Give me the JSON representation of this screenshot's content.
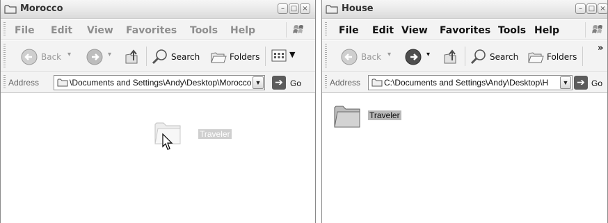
{
  "windows": [
    {
      "title": "Morocco",
      "menu": [
        "File",
        "Edit",
        "View",
        "Favorites",
        "Tools",
        "Help"
      ],
      "toolbar": {
        "back": "Back",
        "search": "Search",
        "folders": "Folders"
      },
      "address": {
        "label": "Address",
        "value": "\\Documents and Settings\\Andy\\Desktop\\Morocco",
        "go": "Go"
      },
      "items": [
        {
          "name": "Traveler",
          "state": "dragging"
        }
      ]
    },
    {
      "title": "House",
      "menu": [
        "File",
        "Edit",
        "View",
        "Favorites",
        "Tools",
        "Help"
      ],
      "toolbar": {
        "back": "Back",
        "search": "Search",
        "folders": "Folders",
        "more": "»"
      },
      "address": {
        "label": "Address",
        "value": "C:\\Documents and Settings\\Andy\\Desktop\\H",
        "go": "Go"
      },
      "items": [
        {
          "name": "Traveler",
          "state": "selected"
        }
      ]
    }
  ],
  "colors": {
    "selection": "#b9b9b9",
    "chrome": "#f3f3f3",
    "go_button": "#5c5c5c"
  },
  "icons": [
    "folder-icon",
    "back-icon",
    "forward-icon",
    "up-folder-icon",
    "search-icon",
    "folders-icon",
    "views-icon",
    "windows-logo-icon",
    "go-arrow-icon",
    "mouse-cursor-icon"
  ]
}
